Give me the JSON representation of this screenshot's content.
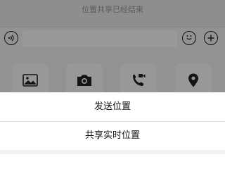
{
  "chat": {
    "system_notice": "位置共享已经结束"
  },
  "input_bar": {
    "voice_icon": "voice-icon",
    "emoji_icon": "emoji-icon",
    "plus_icon": "plus-icon"
  },
  "more_panel": {
    "tools": [
      {
        "icon": "photo-icon"
      },
      {
        "icon": "camera-icon"
      },
      {
        "icon": "video-call-icon"
      },
      {
        "icon": "location-pin-icon"
      }
    ]
  },
  "action_sheet": {
    "send_location": "发送位置",
    "share_live_location": "共享实时位置"
  }
}
